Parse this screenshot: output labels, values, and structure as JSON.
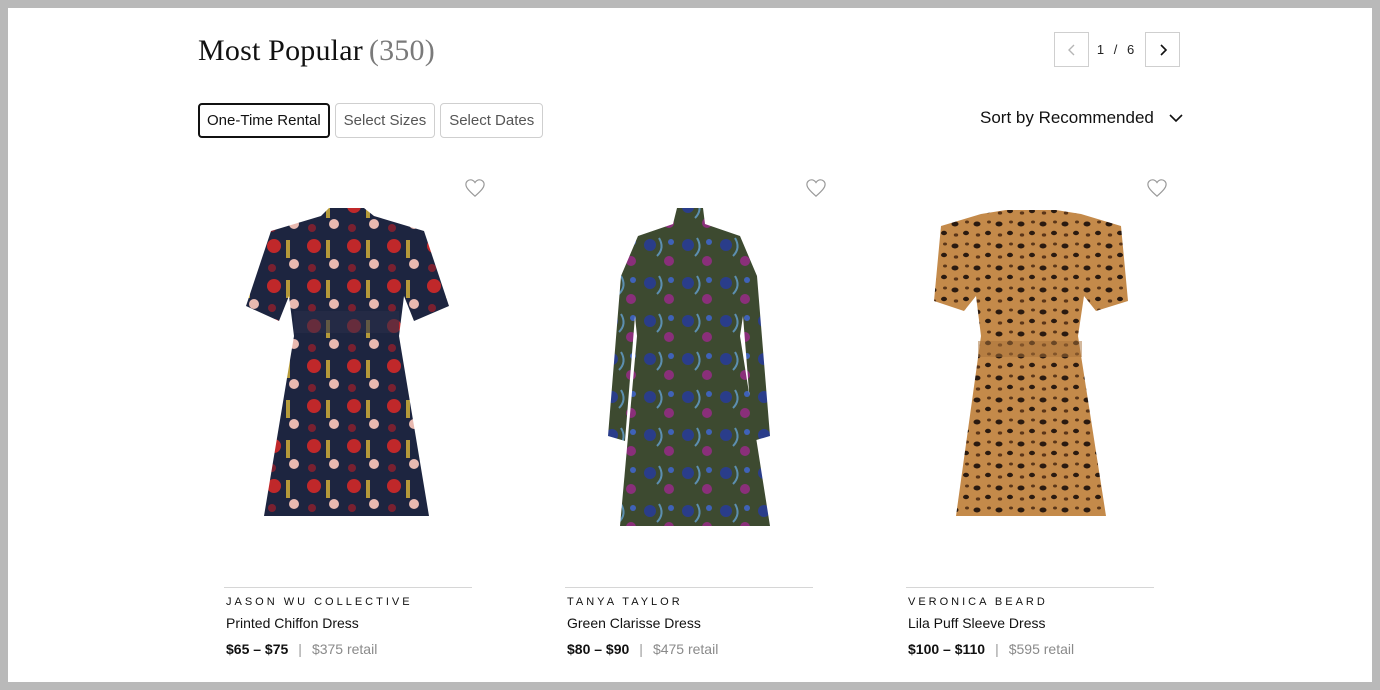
{
  "header": {
    "title": "Most Popular",
    "count": "(350)"
  },
  "pager": {
    "current": "1",
    "separator": "/",
    "total": "6"
  },
  "filters": [
    "One-Time Rental",
    "Select Sizes",
    "Select Dates"
  ],
  "sort": {
    "label": "Sort by Recommended"
  },
  "products": [
    {
      "brand": "JASON WU COLLECTIVE",
      "name": "Printed Chiffon Dress",
      "price_range": "$65 – $75",
      "retail": "$375 retail"
    },
    {
      "brand": "TANYA TAYLOR",
      "name": "Green Clarisse Dress",
      "price_range": "$80 – $90",
      "retail": "$475 retail"
    },
    {
      "brand": "VERONICA BEARD",
      "name": "Lila Puff Sleeve Dress",
      "price_range": "$100 – $110",
      "retail": "$595 retail"
    }
  ],
  "colors": {
    "accent": "#111111",
    "muted": "#8a8a8a",
    "border": "#cfcfcf"
  }
}
